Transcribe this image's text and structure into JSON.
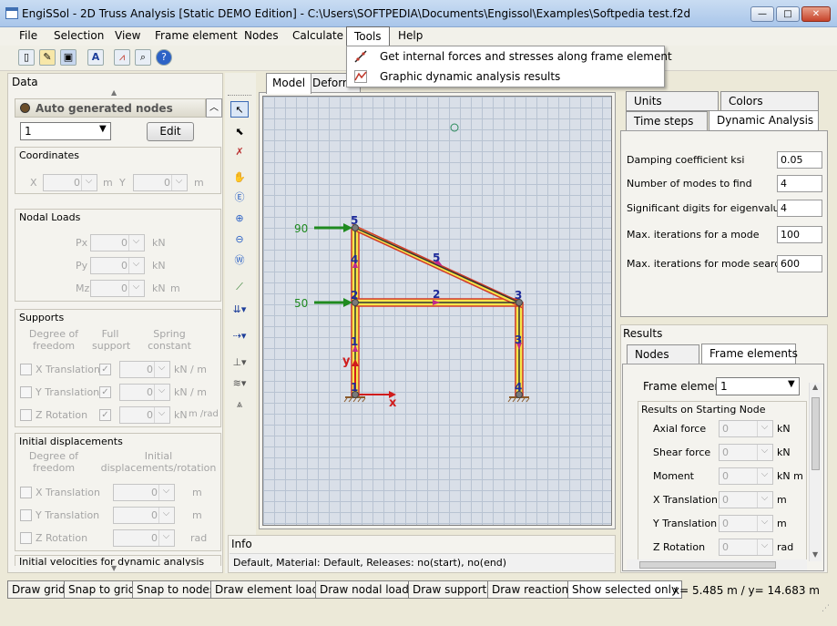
{
  "window": {
    "title": "EngiSSol - 2D Truss Analysis [Static DEMO Edition]   -  C:\\Users\\SOFTPEDIA\\Documents\\Engissol\\Examples\\Softpedia test.f2d",
    "controls": {
      "minimize": "—",
      "maximize": "□",
      "close": "✕"
    }
  },
  "menu": [
    "File",
    "Selection",
    "View",
    "Frame element",
    "Nodes",
    "Calculate",
    "Tools",
    "Help"
  ],
  "tools_menu": [
    {
      "label": "Get internal forces and stresses along frame element",
      "icon": "line-chart-icon"
    },
    {
      "label": "Graphic dynamic analysis results",
      "icon": "mountain-chart-icon"
    }
  ],
  "data_panel": {
    "title": "Data",
    "auto_nodes": "Auto generated nodes",
    "node_select": "1",
    "edit_button": "Edit",
    "coordinates": {
      "title": "Coordinates",
      "x_label": "X",
      "y_label": "Y",
      "x_value": "0",
      "y_value": "0",
      "unit": "m"
    },
    "nodal_loads": {
      "title": "Nodal Loads",
      "px": "Px",
      "py": "Py",
      "mz": "Mz",
      "value": "0",
      "kn": "kN",
      "m": "m"
    },
    "supports": {
      "title": "Supports",
      "col1": "Degree of freedom",
      "col2": "Full support",
      "col3": "Spring constant",
      "rows": [
        {
          "label": "X Translation",
          "full": true,
          "value": "0",
          "unit": "kN",
          "unit2": "/ m"
        },
        {
          "label": "Y Translation",
          "full": true,
          "value": "0",
          "unit": "kN",
          "unit2": "/ m"
        },
        {
          "label": "Z Rotation",
          "full": true,
          "value": "0",
          "unit": "kN",
          "unit2": "m /rad"
        }
      ]
    },
    "initial_displacements": {
      "title": "Initial displacements",
      "col1": "Degree of freedom",
      "col2": "Initial displacements/rotation",
      "rows": [
        {
          "label": "X Translation",
          "value": "0",
          "unit": "m"
        },
        {
          "label": "Y Translation",
          "value": "0",
          "unit": "m"
        },
        {
          "label": "Z Rotation",
          "value": "0",
          "unit": "rad"
        }
      ]
    },
    "initial_velocities": "Initial velocities for dynamic analysis"
  },
  "canvas": {
    "tabs": [
      "Model",
      "Deforme"
    ],
    "load_labels": [
      "90",
      "50"
    ],
    "node_labels": [
      "5",
      "2",
      "3",
      "1",
      "4"
    ],
    "element_labels": [
      "5",
      "2",
      "4",
      "1",
      "3"
    ],
    "axis_x": "x",
    "axis_y": "y"
  },
  "info": {
    "title": "Info",
    "text": "Default, Material: Default, Releases: no(start), no(end)"
  },
  "right_tabs": {
    "row1": [
      "Units",
      "Colors"
    ],
    "row2": [
      "Time steps",
      "Dynamic Analysis"
    ]
  },
  "dynamic": [
    {
      "label": "Damping coefficient ksi",
      "value": "0.05"
    },
    {
      "label": "Number of modes to find",
      "value": "4"
    },
    {
      "label": "Significant digits for eigenvalues",
      "value": "4"
    },
    {
      "label": "Max. iterations for a mode",
      "value": "100"
    },
    {
      "label": "Max. iterations for mode searches",
      "value": "600"
    }
  ],
  "results": {
    "title": "Results",
    "tabs": [
      "Nodes",
      "Frame elements"
    ],
    "frame_element_label": "Frame element",
    "frame_element_value": "1",
    "group_title": "Results on Starting Node",
    "rows": [
      {
        "label": "Axial force",
        "value": "0",
        "unit": "kN"
      },
      {
        "label": "Shear force",
        "value": "0",
        "unit": "kN"
      },
      {
        "label": "Moment",
        "value": "0",
        "unit": "kN m"
      },
      {
        "label": "X Translation",
        "value": "0",
        "unit": "m"
      },
      {
        "label": "Y Translation",
        "value": "0",
        "unit": "m"
      },
      {
        "label": "Z Rotation",
        "value": "0",
        "unit": "rad"
      }
    ]
  },
  "statusbar": {
    "buttons": [
      "Draw grid",
      "Snap to grid",
      "Snap to nodes",
      "Draw element loads",
      "Draw nodal loads",
      "Draw supports",
      "Draw reactions",
      "Show selected only"
    ],
    "coords": "x= 5.485 m / y= 14.683 m"
  }
}
